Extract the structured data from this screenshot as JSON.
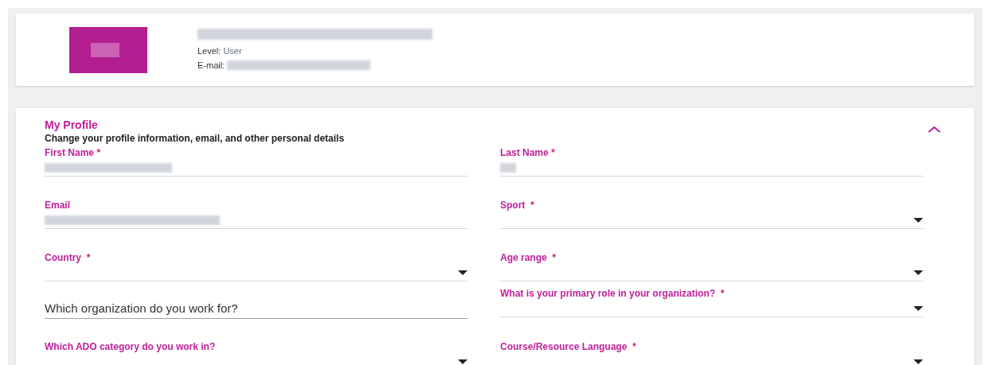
{
  "account": {
    "name_blurred": true,
    "level_label": "Level:",
    "level_value": "User",
    "email_label": "E-mail:",
    "email_blurred": true
  },
  "profile": {
    "title": "My Profile",
    "subtitle": "Change your profile information, email, and other personal details",
    "expanded": true,
    "fields": [
      {
        "kind": "text",
        "label": "First Name",
        "required_mark": "*",
        "value_blurred": true
      },
      {
        "kind": "text",
        "label": "Email",
        "value_blurred": true
      },
      {
        "kind": "select",
        "label": "Country",
        "required_mark": "*"
      },
      {
        "kind": "input",
        "placeholder": "Which organization do you work for?"
      },
      {
        "kind": "select",
        "label": "Which ADO category do you work in?"
      },
      {
        "kind": "text",
        "label": "Last Name",
        "required_mark": "*",
        "value_blurred": true
      },
      {
        "kind": "select",
        "label": "Sport",
        "required_mark": "*"
      },
      {
        "kind": "select",
        "label": "Age range",
        "required_mark": "*"
      },
      {
        "kind": "select",
        "label": "What is your primary role in your organization?",
        "required_mark": "*"
      },
      {
        "kind": "select",
        "label": "Course/Resource Language",
        "required_mark": "*"
      }
    ]
  }
}
